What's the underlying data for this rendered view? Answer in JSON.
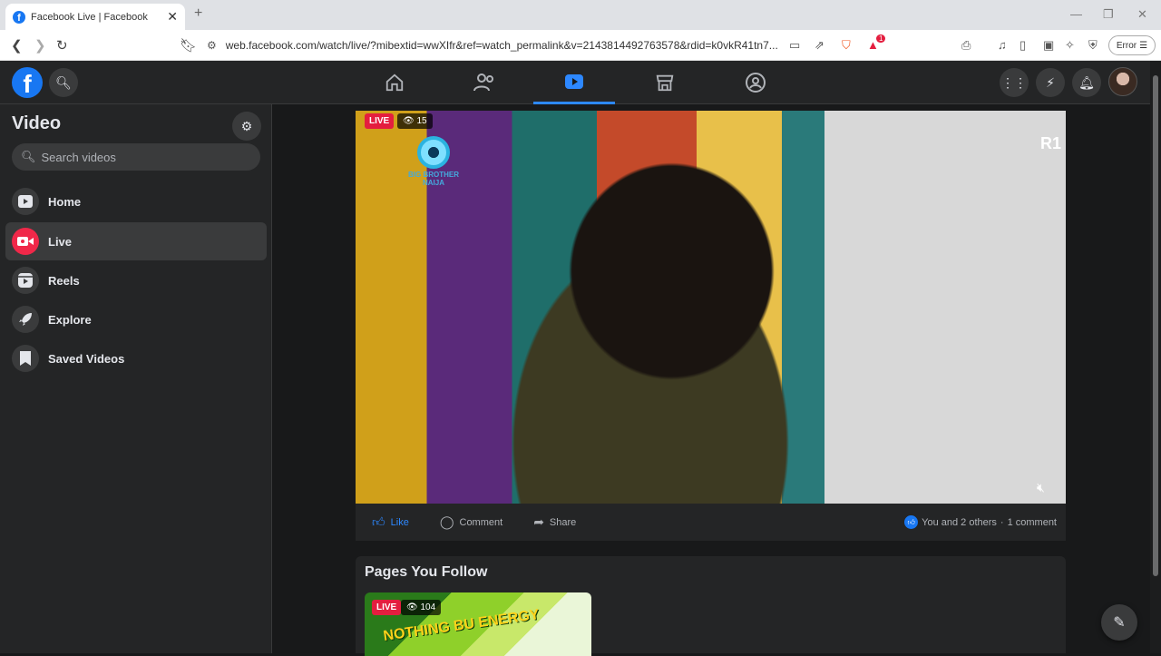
{
  "browser": {
    "tab_title": "Facebook Live | Facebook",
    "url": "web.facebook.com/watch/live/?mibextid=wwXIfr&ref=watch_permalink&v=2143814492763578&rdid=k0vkR41tn7...",
    "error_label": "Error",
    "extension_badge": "1"
  },
  "sidebar": {
    "title": "Video",
    "search_placeholder": "Search videos",
    "items": [
      {
        "label": "Home",
        "icon": "play-icon"
      },
      {
        "label": "Live",
        "icon": "live-camera-icon"
      },
      {
        "label": "Reels",
        "icon": "reels-icon"
      },
      {
        "label": "Explore",
        "icon": "rocket-icon"
      },
      {
        "label": "Saved Videos",
        "icon": "bookmark-icon"
      }
    ]
  },
  "video": {
    "live_label": "LIVE",
    "viewers": "15",
    "logo_text": "BIG BROTHER NAIJA",
    "channel_mark": "R1"
  },
  "actions": {
    "like": "Like",
    "comment": "Comment",
    "share": "Share",
    "reactions": "You and 2 others",
    "separator": "·",
    "comments": "1 comment"
  },
  "pages_you_follow": {
    "title": "Pages You Follow",
    "live_label": "LIVE",
    "viewers": "104",
    "thumb_text": "NOTHING BU ENERGY"
  },
  "colors": {
    "accent": "#1877f2",
    "live_red": "#e41e3f",
    "background": "#18191a",
    "surface": "#242526"
  }
}
